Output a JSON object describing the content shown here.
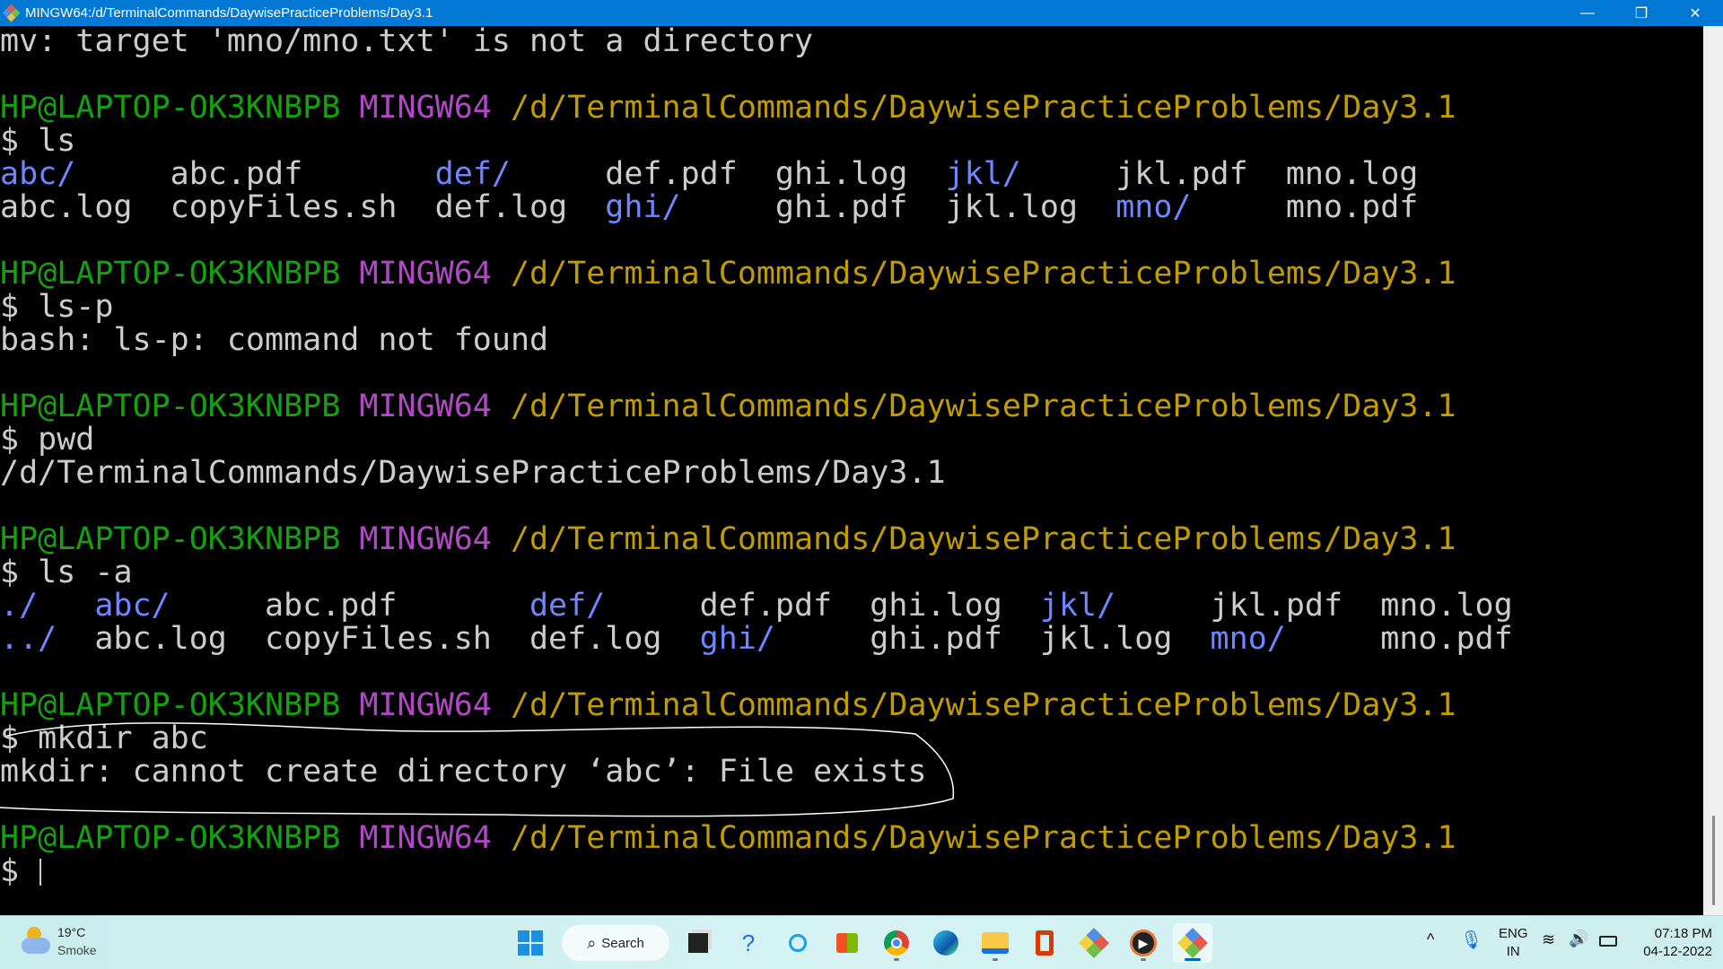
{
  "window": {
    "title": "MINGW64:/d/TerminalCommands/DaywisePracticeProblems/Day3.1",
    "minimize": "—",
    "restore": "❐",
    "close": "✕"
  },
  "prompt": {
    "user": "HP@LAPTOP-OK3KNBPB",
    "shell": "MINGW64",
    "path": "/d/TerminalCommands/DaywisePracticeProblems/Day3.1",
    "sigil": "$"
  },
  "terminal": {
    "line_mv": "mv: target 'mno/mno.txt' is not a directory",
    "cmd_ls": "ls",
    "ls_rows": [
      [
        {
          "t": "abc/",
          "dir": true
        },
        {
          "t": "abc.pdf"
        },
        {
          "t": "def/",
          "dir": true
        },
        {
          "t": "def.pdf"
        },
        {
          "t": "ghi.log"
        },
        {
          "t": "jkl/",
          "dir": true
        },
        {
          "t": "jkl.pdf"
        },
        {
          "t": "mno.log"
        }
      ],
      [
        {
          "t": "abc.log"
        },
        {
          "t": "copyFiles.sh"
        },
        {
          "t": "def.log"
        },
        {
          "t": "ghi/",
          "dir": true
        },
        {
          "t": "ghi.pdf"
        },
        {
          "t": "jkl.log"
        },
        {
          "t": "mno/",
          "dir": true
        },
        {
          "t": "mno.pdf"
        }
      ]
    ],
    "cmd_lsp": "ls-p",
    "out_lsp": "bash: ls-p: command not found",
    "cmd_pwd": "pwd",
    "out_pwd": "/d/TerminalCommands/DaywisePracticeProblems/Day3.1",
    "cmd_lsa": "ls -a",
    "lsa_rows": [
      [
        {
          "t": "./",
          "dir": true
        },
        {
          "t": "abc/",
          "dir": true
        },
        {
          "t": "abc.pdf"
        },
        {
          "t": "def/",
          "dir": true
        },
        {
          "t": "def.pdf"
        },
        {
          "t": "ghi.log"
        },
        {
          "t": "jkl/",
          "dir": true
        },
        {
          "t": "jkl.pdf"
        },
        {
          "t": "mno.log"
        }
      ],
      [
        {
          "t": "../",
          "dir": true
        },
        {
          "t": "abc.log"
        },
        {
          "t": "copyFiles.sh"
        },
        {
          "t": "def.log"
        },
        {
          "t": "ghi/",
          "dir": true
        },
        {
          "t": "ghi.pdf"
        },
        {
          "t": "jkl.log"
        },
        {
          "t": "mno/",
          "dir": true
        },
        {
          "t": "mno.pdf"
        }
      ]
    ],
    "cmd_mkdir": "mkdir abc",
    "out_mkdir": "mkdir: cannot create directory ‘abc’: File exists"
  },
  "colors": {
    "user": "#13a10e",
    "shell": "#b148c6",
    "path": "#c19c00",
    "dir": "#6f86ff",
    "text": "#cccccc",
    "titlebar": "#0078d4"
  },
  "taskbar": {
    "weather": {
      "temp": "19°C",
      "condition": "Smoke",
      "icon": "moon-cloud-icon"
    },
    "search_label": "Search",
    "tray": {
      "lang1": "ENG",
      "lang2": "IN",
      "time": "07:18 PM",
      "date": "04-12-2022"
    }
  }
}
